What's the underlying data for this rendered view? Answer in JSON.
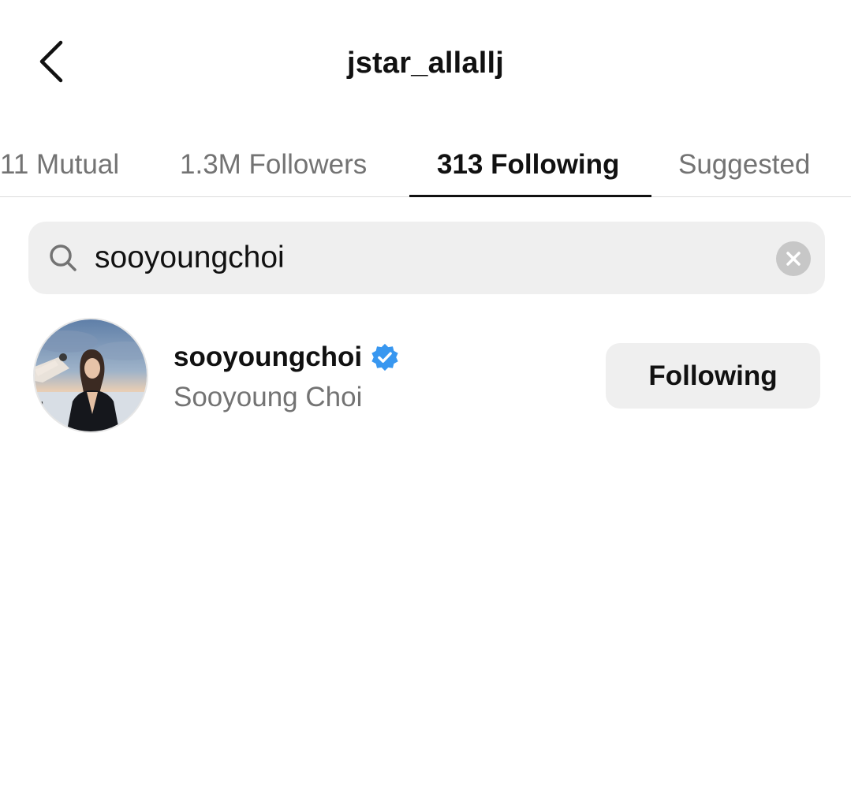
{
  "header": {
    "title": "jstar_allallj",
    "back_icon": "chevron-left-icon"
  },
  "tabs": [
    {
      "label": "11 Mutual",
      "active": false
    },
    {
      "label": "1.3M Followers",
      "active": false
    },
    {
      "label": "313 Following",
      "active": true
    },
    {
      "label": "Suggested",
      "active": false
    }
  ],
  "search": {
    "value": "sooyoungchoi",
    "icon": "search-icon",
    "clear_icon": "clear-circle-icon"
  },
  "results": [
    {
      "username": "sooyoungchoi",
      "verified": true,
      "full_name": "Sooyoung Choi",
      "button_label": "Following"
    }
  ],
  "colors": {
    "text_primary": "#111111",
    "text_secondary": "#737373",
    "search_bg": "#efefef",
    "button_bg": "#efefef",
    "verified_blue": "#3897f0",
    "divider": "#dbdbdb"
  }
}
